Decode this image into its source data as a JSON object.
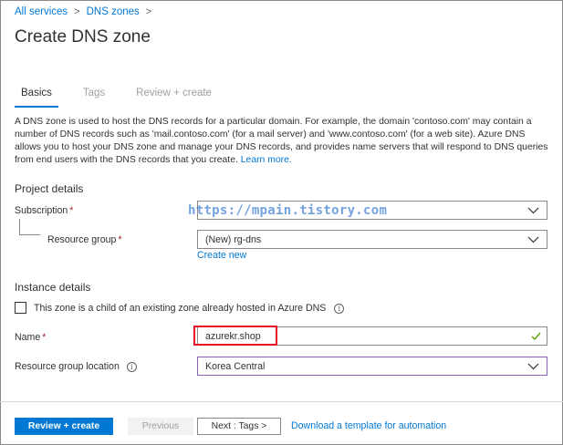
{
  "breadcrumb": {
    "items": [
      "All services",
      "DNS zones"
    ],
    "separator": ">"
  },
  "page": {
    "title": "Create DNS zone"
  },
  "tabs": [
    {
      "label": "Basics",
      "active": true
    },
    {
      "label": "Tags",
      "active": false
    },
    {
      "label": "Review + create",
      "active": false
    }
  ],
  "description": {
    "text": "A DNS zone is used to host the DNS records for a particular domain. For example, the domain 'contoso.com' may contain a number of DNS records such as 'mail.contoso.com' (for a mail server) and 'www.contoso.com' (for a web site). Azure DNS allows you to host your DNS zone and manage your DNS records, and provides name servers that will respond to DNS queries from end users with the DNS records that you create.",
    "learn_more": "Learn more."
  },
  "project_details": {
    "title": "Project details",
    "subscription_label": "Subscription",
    "subscription_value": "",
    "resource_group_label": "Resource group",
    "resource_group_value": "(New) rg-dns",
    "create_new": "Create new"
  },
  "instance_details": {
    "title": "Instance details",
    "child_zone_label": "This zone is a child of an existing zone already hosted in Azure DNS",
    "child_zone_checked": false,
    "name_label": "Name",
    "name_value": "azurekr.shop",
    "location_label": "Resource group location",
    "location_value": "Korea Central"
  },
  "required_marker": "*",
  "watermark": "https://mpain.tistory.com",
  "footer": {
    "review_create": "Review + create",
    "previous": "Previous",
    "next": "Next : Tags >",
    "download": "Download a template for automation"
  },
  "colors": {
    "accent": "#0078d4",
    "required": "#a4262c",
    "highlight": "#e81123",
    "valid": "#57a300",
    "location_border": "#8764b8"
  }
}
